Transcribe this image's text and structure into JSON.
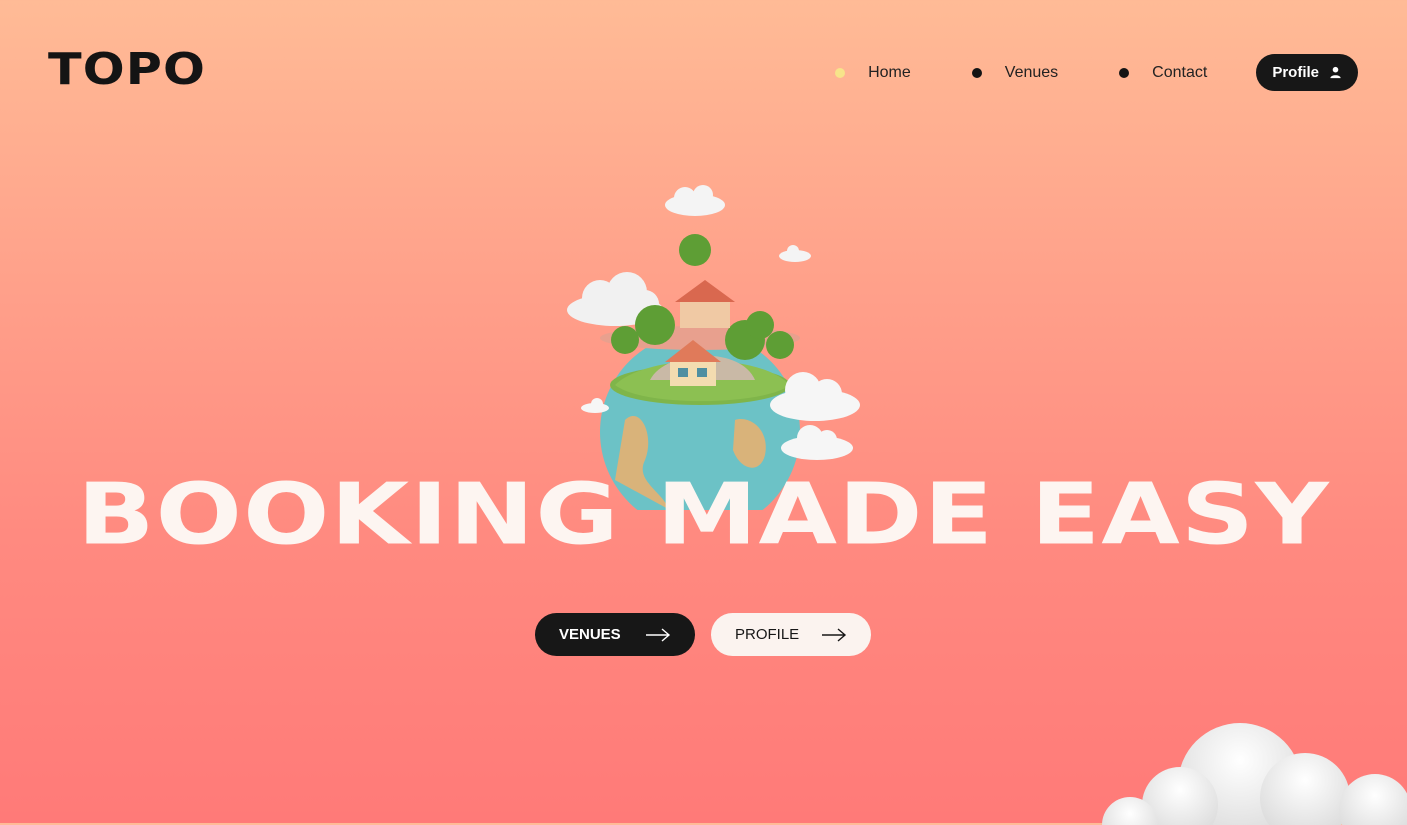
{
  "brand": {
    "logo": "TOPO"
  },
  "nav": {
    "items": [
      {
        "label": "Home",
        "active": true
      },
      {
        "label": "Venues",
        "active": false
      },
      {
        "label": "Contact",
        "active": false
      }
    ],
    "profile_label": "Profile"
  },
  "hero": {
    "headline": "BOOKING MADE EASY",
    "buttons": {
      "venues": "VENUES",
      "profile": "PROFILE"
    }
  },
  "icons": {
    "profile_button": "user-icon",
    "cta": "arrow-right-icon",
    "illustration": "globe-island-houses-illustration",
    "decoration": "cloud-icon"
  },
  "colors": {
    "accent_dark": "#171717",
    "active_dot": "#f7e48a",
    "headline": "#fdf5f1",
    "bg_top": "#ffbb96",
    "bg_bottom": "#ff7a78"
  }
}
